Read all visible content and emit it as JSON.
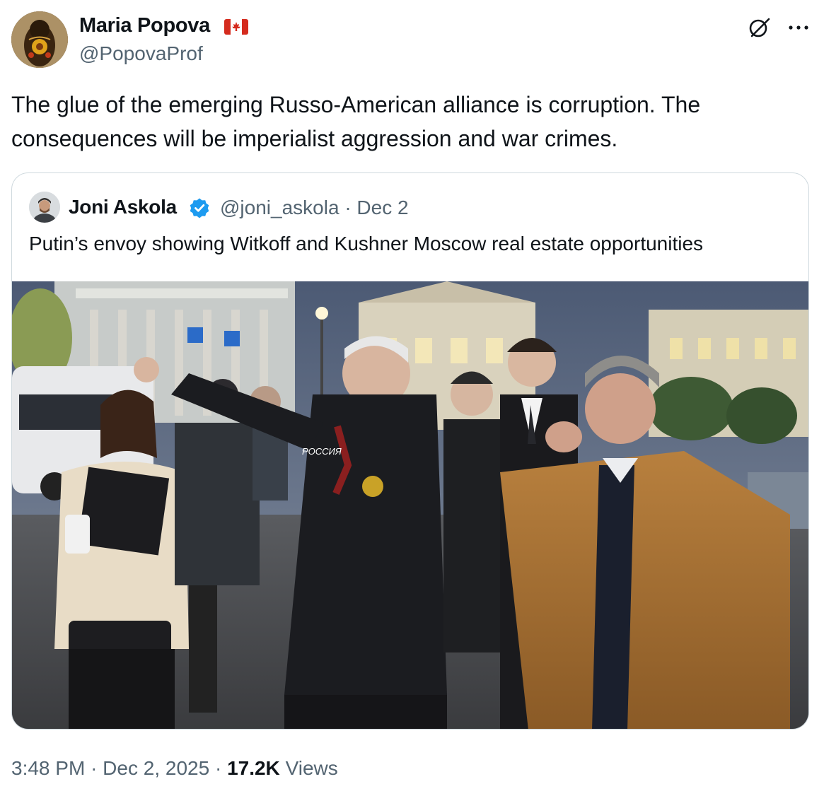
{
  "author": {
    "name": "Maria Popova",
    "handle": "@PopovaProf",
    "flag_icon": "canada-flag-icon"
  },
  "tweet": {
    "text": "The glue of the emerging Russo-American alliance is corruption. The consequences will be imperialist aggression and war crimes."
  },
  "header_actions": {
    "grok_icon": "grok-icon",
    "more_icon": "more-horizontal-icon"
  },
  "quoted": {
    "name": "Joni Askola",
    "verified_icon": "verified-badge-icon",
    "handle": "@joni_askola",
    "separator": "·",
    "date": "Dec 2",
    "text": "Putin’s envoy showing Witkoff and Kushner Moscow real estate opportunities",
    "photo_label": "ⱣOCCИЯ"
  },
  "meta": {
    "time": "3:48 PM",
    "sep1": "·",
    "date": "Dec 2, 2025",
    "sep2": "·",
    "views_count": "17.2K",
    "views_label": "Views"
  },
  "colors": {
    "text_primary": "#0f1419",
    "text_secondary": "#536471",
    "border": "#cfd9de",
    "verified_blue": "#1d9bf0",
    "canada_red": "#d52b1e"
  }
}
